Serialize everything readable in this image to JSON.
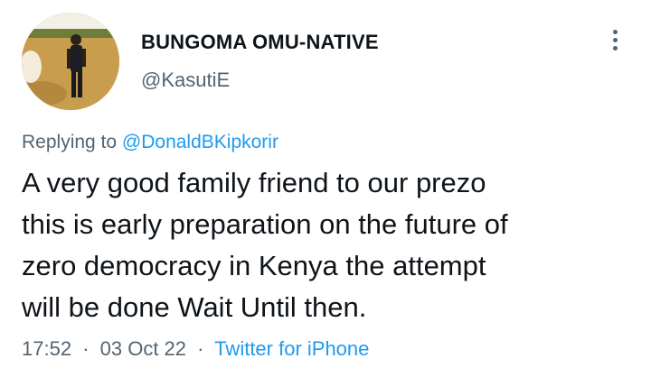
{
  "user": {
    "display_name": "BUNGOMA OMU-NATIVE",
    "handle": "@KasutiE"
  },
  "reply": {
    "prefix": "Replying to",
    "to_handle": "@DonaldBKipkorir"
  },
  "tweet": {
    "lines": [
      "A very good family friend to our prezo",
      "this is early preparation on the future of",
      "zero democracy in Kenya the attempt",
      "will be done Wait Until then."
    ]
  },
  "meta": {
    "time": "17:52",
    "separator": "·",
    "date": "03 Oct 22",
    "source": "Twitter for iPhone"
  },
  "colors": {
    "link": "#1d9bf0",
    "secondary": "#536471",
    "text": "#0f1419"
  },
  "icons": {
    "more": "vertical-ellipsis"
  }
}
